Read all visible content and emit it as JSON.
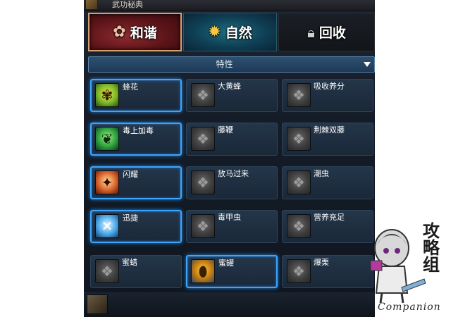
{
  "window": {
    "title": "武功秘典"
  },
  "tabs": [
    {
      "label": "和谐",
      "icon": "flower-icon",
      "state": "selected"
    },
    {
      "label": "自然",
      "icon": "sun-icon",
      "state": "highlighted"
    },
    {
      "label": "回收",
      "icon": "lock-icon",
      "state": "normal"
    }
  ],
  "filter": {
    "selected": "特性",
    "icon": "dropdown-arrow-icon"
  },
  "skills": [
    {
      "name": "蜂花",
      "active": true,
      "icon": "honey-bee-icon"
    },
    {
      "name": "大黄蜂",
      "active": false,
      "icon": "hornet-icon"
    },
    {
      "name": "吸收养分",
      "active": false,
      "icon": "absorb-icon"
    },
    {
      "name": "毒上加毒",
      "active": true,
      "icon": "poison-vine-icon"
    },
    {
      "name": "藤鞭",
      "active": false,
      "icon": "vine-whip-icon"
    },
    {
      "name": "荆棘双藤",
      "active": false,
      "icon": "thorn-vine-icon"
    },
    {
      "name": "闪耀",
      "active": true,
      "icon": "flash-icon"
    },
    {
      "name": "放马过来",
      "active": false,
      "icon": "taunt-icon"
    },
    {
      "name": "潮虫",
      "active": false,
      "icon": "pillbug-icon"
    },
    {
      "name": "迅捷",
      "active": true,
      "icon": "swift-icon"
    },
    {
      "name": "毒甲虫",
      "active": false,
      "icon": "poison-beetle-icon"
    },
    {
      "name": "营养充足",
      "active": false,
      "icon": "nourish-icon"
    },
    {
      "name": "蜜蜡",
      "active": false,
      "icon": "beeswax-icon"
    },
    {
      "name": "蜜罐",
      "active": true,
      "icon": "honey-pot-icon"
    },
    {
      "name": "爆栗",
      "active": false,
      "icon": "chestnut-icon"
    }
  ],
  "watermark": {
    "chars": "攻略组",
    "word": "Companion"
  },
  "colors": {
    "active_border": "#3aa6ff",
    "panel_bg": "#141c28",
    "harmony_tab": "#8d2b30",
    "nature_tab": "#1f6f80"
  }
}
